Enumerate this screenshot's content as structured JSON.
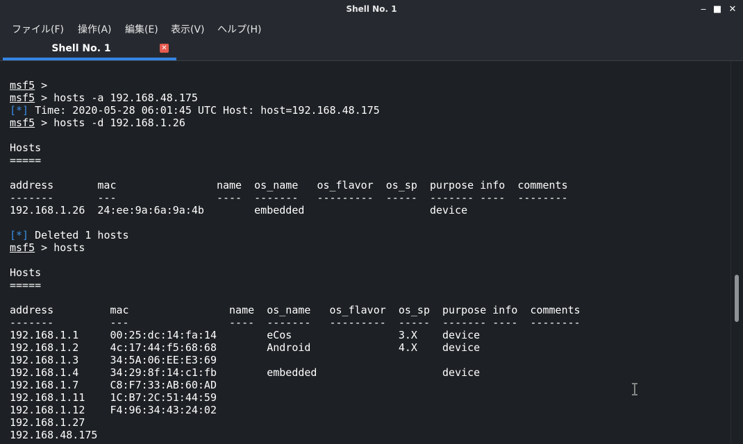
{
  "window": {
    "title": "Shell No. 1",
    "controls": [
      "minimize-icon",
      "maximize-icon",
      "close-icon"
    ]
  },
  "menu": [
    {
      "label": "ファイル(F)"
    },
    {
      "label": "操作(A)"
    },
    {
      "label": "編集(E)"
    },
    {
      "label": "表示(V)"
    },
    {
      "label": "ヘルプ(H)"
    }
  ],
  "tab": {
    "label": "Shell No. 1",
    "close_glyph": "✕",
    "accent": "#3684e4"
  },
  "colors": {
    "background": "#1d2024",
    "text": "#ffffff",
    "info": "#3a8fe8",
    "tab_close": "#e55a4f"
  },
  "terminal": {
    "prompt": "msf5",
    "info_tag": "[*]",
    "lines": [
      {
        "prompt": "msf5",
        "text": " >"
      },
      {
        "prompt": "msf5",
        "text": " > hosts -a 192.168.48.175"
      },
      {
        "tag": "[*]",
        "text": " Time: 2020-05-28 06:01:45 UTC Host: host=192.168.48.175"
      },
      {
        "prompt": "msf5",
        "text": " > hosts -d 192.168.1.26"
      },
      {
        "text": ""
      },
      {
        "text": "Hosts"
      },
      {
        "text": "====="
      },
      {
        "text": ""
      },
      {
        "cells": [
          "address",
          "mac",
          "name",
          "os_name",
          "os_flavor",
          "os_sp",
          "purpose",
          "info",
          "comments"
        ]
      },
      {
        "cells": [
          "-------",
          "---",
          "----",
          "-------",
          "---------",
          "-----",
          "-------",
          "----",
          "--------"
        ]
      },
      {
        "cells": [
          "192.168.1.26",
          "24:ee:9a:6a:9a:4b",
          "",
          "embedded",
          "",
          "",
          "device",
          "",
          ""
        ]
      },
      {
        "text": ""
      },
      {
        "tag": "[*]",
        "text": " Deleted 1 hosts"
      },
      {
        "prompt": "msf5",
        "text": " > hosts"
      },
      {
        "text": ""
      },
      {
        "text": "Hosts"
      },
      {
        "text": "====="
      },
      {
        "text": ""
      },
      {
        "cells": [
          "address",
          "mac",
          "name",
          "os_name",
          "os_flavor",
          "os_sp",
          "purpose",
          "info",
          "comments"
        ]
      },
      {
        "cells": [
          "-------",
          "---",
          "----",
          "-------",
          "---------",
          "-----",
          "-------",
          "----",
          "--------"
        ]
      },
      {
        "cells": [
          "192.168.1.1",
          "00:25:dc:14:fa:14",
          "",
          "eCos",
          "",
          "3.X",
          "device",
          "",
          ""
        ]
      },
      {
        "cells": [
          "192.168.1.2",
          "4c:17:44:f5:68:68",
          "",
          "Android",
          "",
          "4.X",
          "device",
          "",
          ""
        ]
      },
      {
        "cells": [
          "192.168.1.3",
          "34:5A:06:EE:E3:69",
          "",
          "",
          "",
          "",
          "",
          "",
          ""
        ]
      },
      {
        "cells": [
          "192.168.1.4",
          "34:29:8f:14:c1:fb",
          "",
          "embedded",
          "",
          "",
          "device",
          "",
          ""
        ]
      },
      {
        "cells": [
          "192.168.1.7",
          "C8:F7:33:AB:60:AD",
          "",
          "",
          "",
          "",
          "",
          "",
          ""
        ]
      },
      {
        "cells": [
          "192.168.1.11",
          "1C:B7:2C:51:44:59",
          "",
          "",
          "",
          "",
          "",
          "",
          ""
        ]
      },
      {
        "cells": [
          "192.168.1.12",
          "F4:96:34:43:24:02",
          "",
          "",
          "",
          "",
          "",
          "",
          ""
        ]
      },
      {
        "cells": [
          "192.168.1.27",
          "",
          "",
          "",
          "",
          "",
          "",
          "",
          ""
        ]
      },
      {
        "cells": [
          "192.168.48.175",
          "",
          "",
          "",
          "",
          "",
          "",
          "",
          ""
        ]
      }
    ]
  }
}
